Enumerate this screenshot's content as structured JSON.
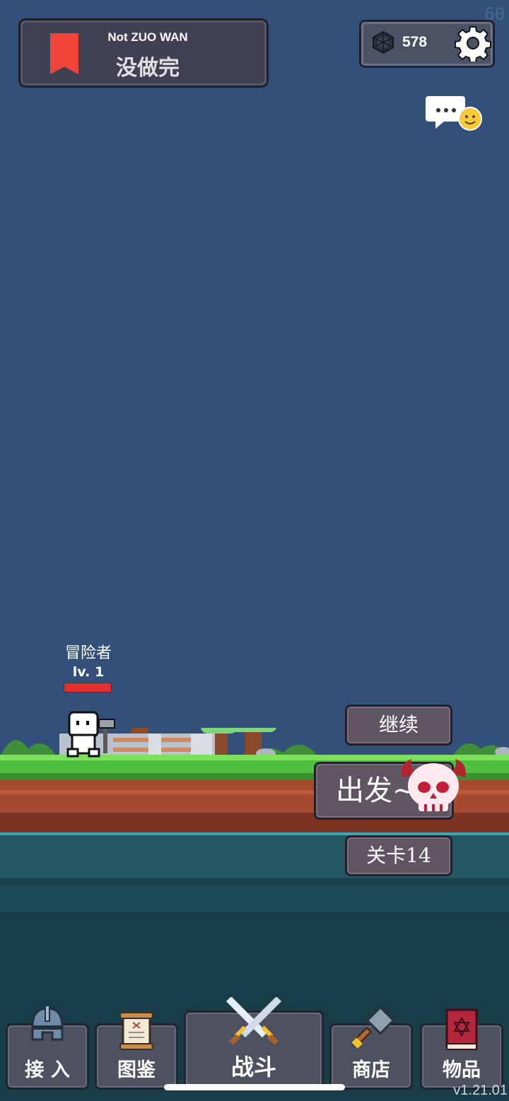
{
  "fps": "60",
  "header": {
    "title_en": "Not ZUO WAN",
    "title_zh": "没做完"
  },
  "currency": {
    "icon": "gem-icon",
    "value": "578"
  },
  "hero": {
    "name": "冒险者",
    "level": "lv. 1",
    "hp_fraction": 1.0
  },
  "actions": {
    "continue_label": "继续",
    "go_label": "出发~",
    "stage_label": "关卡14"
  },
  "nav": {
    "items": [
      {
        "label": "接 入",
        "icon": "helmet-icon"
      },
      {
        "label": "图鉴",
        "icon": "scroll-icon"
      },
      {
        "label": "战斗",
        "icon": "crossed-swords-icon"
      },
      {
        "label": "商店",
        "icon": "hammer-icon"
      },
      {
        "label": "物品",
        "icon": "spellbook-icon"
      }
    ]
  },
  "version": "v1.21.01",
  "colors": {
    "sky": "#33507a",
    "grass": "#4fbf3f",
    "dirt": "#a5492f",
    "water": "#1d4a57",
    "accent_red": "#f0443a"
  }
}
